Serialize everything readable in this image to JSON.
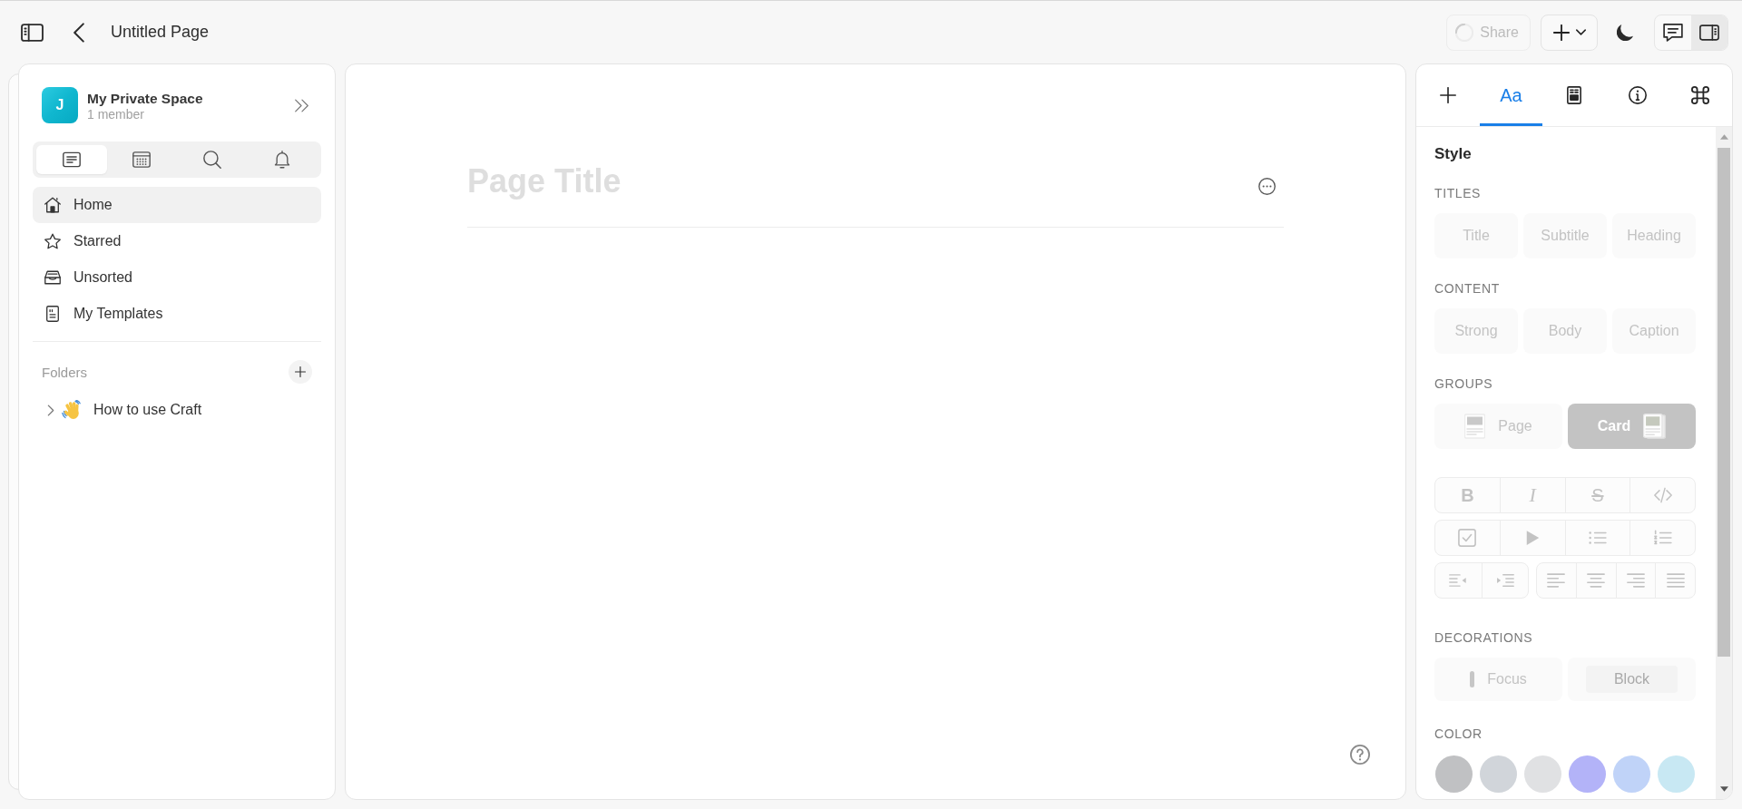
{
  "topbar": {
    "title": "Untitled Page",
    "share": {
      "label": "Share",
      "disabled": true,
      "loading": true
    },
    "toggles": [
      {
        "kind": "comments",
        "selected": false
      },
      {
        "kind": "inspector",
        "selected": true
      }
    ]
  },
  "sidebar": {
    "space": {
      "initial": "J",
      "name": "My Private Space",
      "members": "1 member"
    },
    "view_tabs": [
      {
        "kind": "documents",
        "selected": true
      },
      {
        "kind": "calendar",
        "selected": false
      },
      {
        "kind": "search",
        "selected": false
      },
      {
        "kind": "notifications",
        "selected": false
      }
    ],
    "nav": [
      {
        "kind": "home",
        "label": "Home",
        "selected": true
      },
      {
        "kind": "starred",
        "label": "Starred",
        "selected": false
      },
      {
        "kind": "unsorted",
        "label": "Unsorted",
        "selected": false
      },
      {
        "kind": "templates",
        "label": "My Templates",
        "selected": false
      }
    ],
    "folders": {
      "title": "Folders",
      "items": [
        {
          "label": "How to use Craft",
          "expanded": false
        }
      ]
    }
  },
  "editor": {
    "title": {
      "placeholder": "Page Title"
    }
  },
  "inspector": {
    "tabs": [
      {
        "kind": "insert",
        "selected": false
      },
      {
        "kind": "style",
        "label": "Aa",
        "selected": true
      },
      {
        "kind": "card",
        "selected": false
      },
      {
        "kind": "info",
        "selected": false
      },
      {
        "kind": "shortcuts",
        "selected": false
      }
    ],
    "heading": "Style",
    "sections": [
      {
        "kind": "options",
        "title": "TITLES",
        "disabled": true,
        "options": [
          {
            "label": "Title",
            "selected": false
          },
          {
            "label": "Subtitle",
            "selected": false
          },
          {
            "label": "Heading",
            "selected": false
          }
        ]
      },
      {
        "kind": "options",
        "title": "CONTENT",
        "disabled": true,
        "options": [
          {
            "label": "Strong",
            "selected": false
          },
          {
            "label": "Body",
            "selected": false
          },
          {
            "label": "Caption",
            "selected": false
          }
        ]
      },
      {
        "kind": "groups",
        "title": "GROUPS",
        "disabled": true,
        "options": [
          {
            "kind": "page",
            "label": "Page",
            "selected": false
          },
          {
            "kind": "card",
            "label": "Card",
            "selected": true
          }
        ]
      },
      {
        "kind": "formatting",
        "disabled": true,
        "rows": [
          [
            [
              {
                "kind": "bold",
                "label": "B"
              },
              {
                "kind": "italic",
                "label": "I"
              },
              {
                "kind": "strikethrough",
                "label": "S"
              },
              {
                "kind": "code"
              }
            ]
          ],
          [
            [
              {
                "kind": "checkbox"
              },
              {
                "kind": "toggle"
              },
              {
                "kind": "bullet-list"
              },
              {
                "kind": "numbered-list"
              }
            ]
          ],
          [
            [
              {
                "kind": "outdent"
              },
              {
                "kind": "indent"
              }
            ],
            [
              {
                "kind": "align-left"
              },
              {
                "kind": "align-center"
              },
              {
                "kind": "align-right"
              },
              {
                "kind": "justify"
              }
            ]
          ]
        ]
      },
      {
        "kind": "decorations",
        "title": "DECORATIONS",
        "disabled": true,
        "options": [
          {
            "kind": "focus",
            "label": "Focus",
            "selected": false
          },
          {
            "kind": "block",
            "label": "Block",
            "selected": false
          }
        ]
      },
      {
        "kind": "colors",
        "title": "COLOR",
        "swatches": [
          {
            "color": "#c0c1c3",
            "selected": false
          },
          {
            "color": "#d1d5da",
            "selected": false
          },
          {
            "color": "#e0e1e3",
            "selected": false
          },
          {
            "color": "#b3b3f8",
            "selected": false
          },
          {
            "color": "#c0d3f8",
            "selected": false
          },
          {
            "color": "#c8e8f3",
            "selected": false
          }
        ]
      }
    ]
  }
}
